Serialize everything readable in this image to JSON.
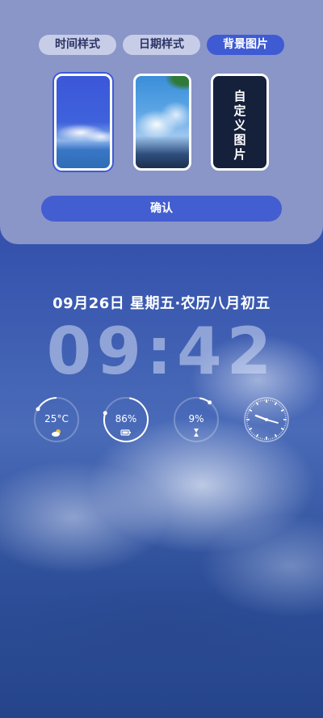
{
  "status_bar": {
    "battery_level": "86",
    "icons": [
      "close-box-icon",
      "wifi-icon",
      "battery-icon",
      "charging-bolt-icon"
    ]
  },
  "settings_panel": {
    "tabs": [
      {
        "label": "时间样式",
        "selected": false
      },
      {
        "label": "日期样式",
        "selected": false
      },
      {
        "label": "背景图片",
        "selected": true
      }
    ],
    "wallpapers": [
      {
        "name": "sea-clouds",
        "selected": true
      },
      {
        "name": "cloud-tree",
        "selected": false
      },
      {
        "name": "custom",
        "label": "自定义图片",
        "selected": false
      }
    ],
    "confirm_label": "确认"
  },
  "lock_screen": {
    "date_line": "09月26日 星期五·农历八月初五",
    "time": "09:42",
    "widgets": [
      {
        "type": "temperature",
        "value": "25°C",
        "icon": "weather-cloud-sun-icon"
      },
      {
        "type": "battery",
        "value": "86%",
        "icon": "battery-icon",
        "level": 0.86
      },
      {
        "type": "storage",
        "value": "9%",
        "icon": "hourglass-icon",
        "level": 0.09
      },
      {
        "type": "clock",
        "icon": "analog-clock-icon"
      }
    ]
  },
  "colors": {
    "panel_bg": "#8a95c8",
    "accent": "#3e5bd3",
    "battery_green": "#66c45c"
  }
}
